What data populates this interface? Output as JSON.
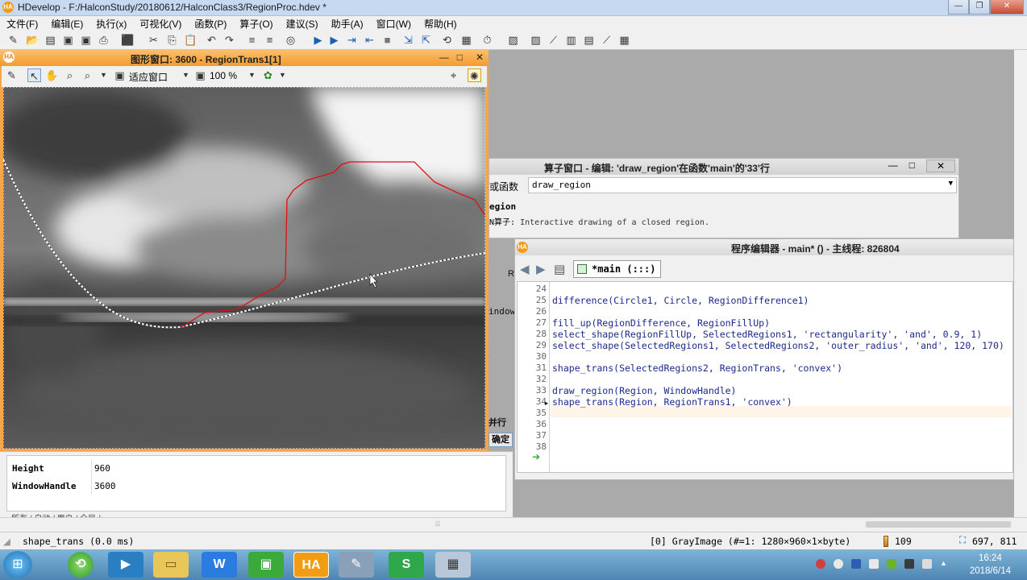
{
  "window": {
    "title": "HDevelop - F:/HalconStudy/20180612/HalconClass3/RegionProc.hdev *",
    "app_icon": "HA"
  },
  "menu": [
    "文件(F)",
    "编辑(E)",
    "执行(x)",
    "可视化(V)",
    "函数(P)",
    "算子(O)",
    "建议(S)",
    "助手(A)",
    "窗口(W)",
    "帮助(H)"
  ],
  "graphics_window": {
    "title": "图形窗口: 3600 - RegionTrans1[1]",
    "fit_label": "适应窗口",
    "zoom": "100 %"
  },
  "variables": {
    "rows": [
      {
        "name": "Height",
        "value": "960"
      },
      {
        "name": "WindowHandle",
        "value": "3600"
      }
    ],
    "tabs_text": "所有 / 自动 / 用户 / 全局 /"
  },
  "operator_window": {
    "title": "算子窗口 - 编辑: 'draw_region'在函数'main'的'33'行",
    "name_label": "或函数",
    "name_value": "draw_region",
    "region_label": "egion",
    "desc_prefix": "N算子:",
    "description": "Interactive drawing of a closed region."
  },
  "side_fragments": {
    "r": "R",
    "window_h": "indowH",
    "parallel": "并行",
    "confirm": "确定"
  },
  "program_editor": {
    "title": "程序编辑器 - main* () - 主线程: 826804",
    "tab_label": "*main (:::)",
    "lines": [
      {
        "n": "24",
        "code": ""
      },
      {
        "n": "25",
        "code": "difference(Circle1, Circle, RegionDifference1)"
      },
      {
        "n": "26",
        "code": ""
      },
      {
        "n": "27",
        "code": "fill_up(RegionDifference, RegionFillUp)"
      },
      {
        "n": "28",
        "code": "select_shape(RegionFillUp, SelectedRegions1, 'rectangularity', 'and', 0.9, 1)"
      },
      {
        "n": "29",
        "code": "select_shape(SelectedRegions1, SelectedRegions2, 'outer_radius', 'and', 120, 170)"
      },
      {
        "n": "30",
        "code": ""
      },
      {
        "n": "31",
        "code": "shape_trans(SelectedRegions2, RegionTrans, 'convex')"
      },
      {
        "n": "32",
        "code": ""
      },
      {
        "n": "33",
        "code": "draw_region(Region, WindowHandle)"
      },
      {
        "n": "34",
        "code": "shape_trans(Region, RegionTrans1, 'convex')"
      },
      {
        "n": "35",
        "code": ""
      },
      {
        "n": "36",
        "code": ""
      },
      {
        "n": "37",
        "code": ""
      },
      {
        "n": "38",
        "code": ""
      }
    ]
  },
  "status": {
    "message": "shape_trans (0.0 ms)",
    "image_info": "[0] GrayImage (#=1: 1280×960×1×byte)",
    "gray_value": "109",
    "coords": "697, 811"
  },
  "taskbar": {
    "time": "16:24",
    "date": "2018/6/14",
    "ha_label": "HA",
    "wps_w": "W",
    "wps_s": "S"
  },
  "colors": {
    "graphics_frame": "#f5a54a",
    "region_red": "#e01010",
    "code_blue": "#1a2a8a"
  }
}
